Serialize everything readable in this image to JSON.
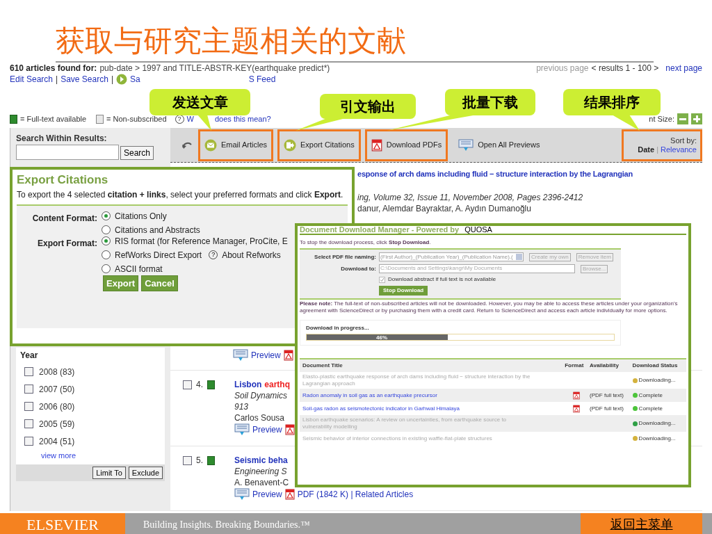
{
  "slide": {
    "title": "获取与研究主题相关的文献",
    "footer": {
      "logo": "ELSEVIER",
      "tagline": "Building Insights. Breaking Boundaries.™",
      "back_link": "返回主菜单"
    }
  },
  "callouts": [
    {
      "label": "发送文章"
    },
    {
      "label": "引文输出"
    },
    {
      "label": "批量下载"
    },
    {
      "label": "结果排序"
    }
  ],
  "header": {
    "count_label": "610 articles found for:",
    "query": "pub-date > 1997 and TITLE-ABSTR-KEY(earthquake predict*)",
    "links": [
      "Edit Search",
      "Save Search"
    ],
    "separator": "|",
    "alert_fragment": "Sa",
    "feed_fragment": "S Feed",
    "pager": {
      "previous": "previous page",
      "range": "< results 1 - 100 >",
      "next": "next page"
    }
  },
  "legend": {
    "full_text": "= Full-text available",
    "non_subscribed": "= Non-subscribed",
    "help_icon": "?",
    "help_start": "W",
    "help_end": "does this mean?",
    "font_size": "nt Size:"
  },
  "toolbar": {
    "actions": [
      {
        "kind": "email",
        "label": "Email Articles",
        "highlighted": true
      },
      {
        "kind": "export",
        "label": "Export Citations",
        "highlighted": true
      },
      {
        "kind": "pdf",
        "label": "Download PDFs",
        "highlighted": true
      },
      {
        "kind": "preview",
        "label": "Open All Previews",
        "highlighted": false
      }
    ],
    "sort": {
      "label": "Sort by:",
      "highlighted": true,
      "separator": "|",
      "options": [
        {
          "label": "Date",
          "selected": true
        },
        {
          "label": "Relevance",
          "selected": false
        }
      ]
    }
  },
  "sidebar": {
    "search_label": "Search Within Results:",
    "search_button": "Search",
    "year_label": "Year",
    "years": [
      {
        "label": "2008 (83)",
        "checked": false
      },
      {
        "label": "2007 (50)",
        "checked": false
      },
      {
        "label": "2006 (80)",
        "checked": false
      },
      {
        "label": "2005 (59)",
        "checked": false
      },
      {
        "label": "2004 (51)",
        "checked": false
      }
    ],
    "view_more": "view more",
    "buttons": [
      "Limit To",
      "Exclude"
    ]
  },
  "results": {
    "first": {
      "title": "esponse of arch dams including fluid − structure interaction by the Lagrangian",
      "source": "ing, Volume 32, Issue 11, November 2008, Pages 2396-2412",
      "authors": "danur, Alemdar Bayraktar, A. Aydın Dumanoğlu",
      "preview": "Preview"
    },
    "items": [
      {
        "number": "4.",
        "checked": false,
        "title": "Lisbon",
        "title_highlight": "earthq",
        "source": "Soil Dynamics",
        "source_more": "913",
        "authors": "Carlos Sousa",
        "preview": "Preview"
      },
      {
        "number": "5.",
        "checked": false,
        "title": "Seismic beha",
        "source": "Engineering S",
        "authors": "A. Benavent-C",
        "preview": "Preview"
      }
    ],
    "last_links": "PDF (1842 K) | Related Articles"
  },
  "export_dialog": {
    "title": "Export Citations",
    "intro": "To export the 4 selected **citation + links**, select your preferred formats and click **Export**.",
    "groups": [
      {
        "label": "Content Format:",
        "options": [
          {
            "label": "Citations Only",
            "selected": true
          },
          {
            "label": "Citations and Abstracts",
            "selected": false
          }
        ]
      },
      {
        "label": "Export Format:",
        "options": [
          {
            "label": "RIS format (for Reference Manager, ProCite, E",
            "selected": true
          },
          {
            "label": "RefWorks Direct Export",
            "selected": false,
            "help_icon": "?",
            "help": "About Refworks"
          },
          {
            "label": "ASCII format",
            "selected": false
          }
        ]
      }
    ],
    "buttons": [
      "Export",
      "Cancel"
    ]
  },
  "download_manager": {
    "title": "Document Download Manager - Powered by",
    "brand": "QUOSA",
    "instruction": "To stop the download process, click **Stop Download**.",
    "naming_label": "Select PDF file naming:",
    "naming_value": "(First Author)_(Publication Year)_(Publication Name).(",
    "create_button": "Create my own",
    "remove_button": "Remove item",
    "download_label": "Download to:",
    "download_path": "C:\\Documents and Settings\\kangr\\My Documents",
    "browse_button": "Browse...",
    "abstract_option": {
      "label": "Download abstract if full text is not available",
      "checked": true
    },
    "stop_button": "Stop Download",
    "note": "**Please note:** The full-text of non-subscribed articles will not be downloaded. However, you may be able to access these articles under your organization's agreement with ScienceDirect or by purchasing them with a credit card. Return to ScienceDirect and access each article individually for more options.",
    "progress": {
      "label": "Download in progress...",
      "level": 0.46,
      "reading": "46%"
    },
    "table": {
      "columns": [
        "Document Title",
        "Format",
        "Availability",
        "Download Status"
      ],
      "rows": [
        {
          "kind": "pending",
          "title": "Elasto-plastic earthquake response of arch dams including fluid − structure interaction by the Lagrangian approach",
          "status": "Downloading...",
          "color": "#d4b23c"
        },
        {
          "kind": "done",
          "title": "Radon anomaly in soil gas as an earthquake precursor",
          "availability": "(PDF full text)",
          "status": "Complete",
          "color": "#4cc43a"
        },
        {
          "kind": "done",
          "title": "Soil-gas radon as seismotectonic indicator in Garhwal Himalaya",
          "availability": "(PDF full text)",
          "status": "Complete",
          "color": "#4cc43a"
        },
        {
          "kind": "pending",
          "title": "Lisbon earthquake scenarios: A review on uncertainties, from earthquake source to vulnerability modelling",
          "status": "Downloading...",
          "color": "#2fa046"
        },
        {
          "kind": "pending",
          "title": "Seismic behavior of interior connections in existing waffle-flat-plate structures",
          "status": "Downloading...",
          "color": "#d4b23c"
        }
      ]
    }
  }
}
